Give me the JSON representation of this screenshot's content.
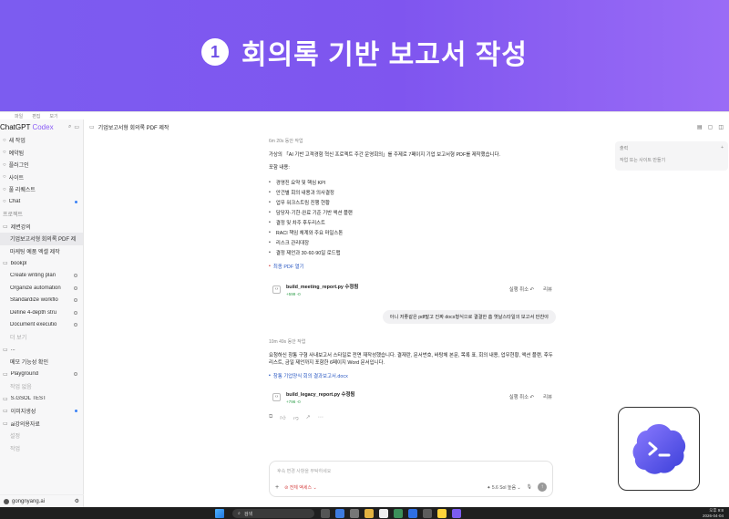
{
  "banner": {
    "number": "1",
    "title": "회의록 기반 보고서 작성"
  },
  "menubar": [
    "파일",
    "편집",
    "보기"
  ],
  "sidebar": {
    "brand": "ChatGPT",
    "brand_accent": "Codex",
    "items": [
      {
        "label": "새 작업",
        "icon": "edit-icon",
        "type": "nav"
      },
      {
        "label": "예약됨",
        "icon": "clock-icon",
        "type": "nav"
      },
      {
        "label": "플러그인",
        "icon": "plugin-icon",
        "type": "nav"
      },
      {
        "label": "사이트",
        "icon": "globe-icon",
        "type": "nav"
      },
      {
        "label": "풀 리퀘스트",
        "icon": "merge-icon",
        "type": "nav"
      },
      {
        "label": "Chat",
        "icon": "chat-icon",
        "type": "nav",
        "badge": "dot"
      },
      {
        "label": "프로젝트",
        "type": "section"
      },
      {
        "label": "제변강의",
        "icon": "folder-icon",
        "type": "project"
      },
      {
        "label": "기업보고서형 회의록 PDF 제",
        "type": "thread",
        "selected": true
      },
      {
        "label": "마케팅 예품 엑셀 제작",
        "type": "thread"
      },
      {
        "label": "bookpl",
        "icon": "folder-icon",
        "type": "project"
      },
      {
        "label": "Create writing plan",
        "type": "thread",
        "badge": "ring"
      },
      {
        "label": "Organize automation",
        "type": "thread",
        "badge": "ring"
      },
      {
        "label": "Standardize workflo",
        "type": "thread",
        "badge": "ring"
      },
      {
        "label": "Define 4-depth stru",
        "type": "thread",
        "badge": "ring"
      },
      {
        "label": "Document executio",
        "type": "thread",
        "badge": "ring"
      },
      {
        "label": "더 보기",
        "type": "more"
      },
      {
        "label": "...",
        "icon": "folder-icon",
        "type": "project"
      },
      {
        "label": "메모 기능성 확인",
        "type": "thread"
      },
      {
        "label": "Playground",
        "icon": "folder-icon",
        "type": "project",
        "badge": "ring"
      },
      {
        "label": "작업 없음",
        "type": "more"
      },
      {
        "label": "S.GSOL TEST",
        "icon": "folder-icon",
        "type": "project"
      },
      {
        "label": "이미지생성",
        "icon": "folder-icon",
        "type": "project",
        "badge": "dot"
      },
      {
        "label": "ai강의용자료",
        "icon": "folder-icon",
        "type": "project"
      },
      {
        "label": "설정",
        "type": "more"
      },
      {
        "label": "작업",
        "type": "more"
      }
    ],
    "user": "gongnyang.ai"
  },
  "header": {
    "title": "기업보고서형 회의록 PDF 제작"
  },
  "thread": {
    "meta1": "6m 20s 동안 작업",
    "intro": "가상의 「AI 기반 고객경험 혁신 프로젝트 주간 운영회의」를 주제로 7페이지 기업 보고서형 PDF를 제작했습니다.",
    "contents_label": "포함 내용:",
    "bullets": [
      "경영진 요약 및 핵심 KPI",
      "안건별 회의 내용과 의사결정",
      "업무 워크스트림 진행 현황",
      "담당자·기한·완료 기준 기반 액션 플랜",
      "결정 및 차주 후두리스트",
      "RACI 책임 체계와 주요 마일스톤",
      "리스크 관리대장",
      "결정 제언과 30·60·90일 로드맵"
    ],
    "pdf_link": "최종 PDF 열기",
    "file1": {
      "name": "build_meeting_report.py 수정됨",
      "diff": "+599 -0"
    },
    "undo": "실행 취소",
    "review": "리뷰",
    "user_msg": "아니 저좋같은 pdf말고 진짜 docs형식으로 결결한 흠 옛날스타일의 보고서 만찬야",
    "meta2": "10m 49s 동안 작업",
    "reply": "요청하신 창통 구형 사내보고서 스타일로 전면 재작성했습니다. 결재란, 문서번호, 바탕체 본문, 목록 표, 회의 내용, 업무현황, 액션 플랜, 후두리스트, 금일 제언까지 포함한 6페이지 Word 문서입니다.",
    "docx_link": "창통 기업양식 회의 결과보고서.docx",
    "file2": {
      "name": "build_legacy_report.py 수정됨",
      "diff": "+796 -0"
    }
  },
  "composer": {
    "placeholder": "후속 변경 사항을 부탁하세요",
    "access": "전체 액세스",
    "model": "5.6 Sol",
    "effort": "높음"
  },
  "right_panel": {
    "title": "출력",
    "placeholder": "작업 또는 사이트 만들기"
  },
  "taskbar": {
    "search": "검색",
    "time": "오후 9:8",
    "date": "2026-04-04"
  },
  "colors": {
    "accent": "#7c5cf0",
    "link": "#2b59c3",
    "diff_add": "#2e9e4a"
  }
}
